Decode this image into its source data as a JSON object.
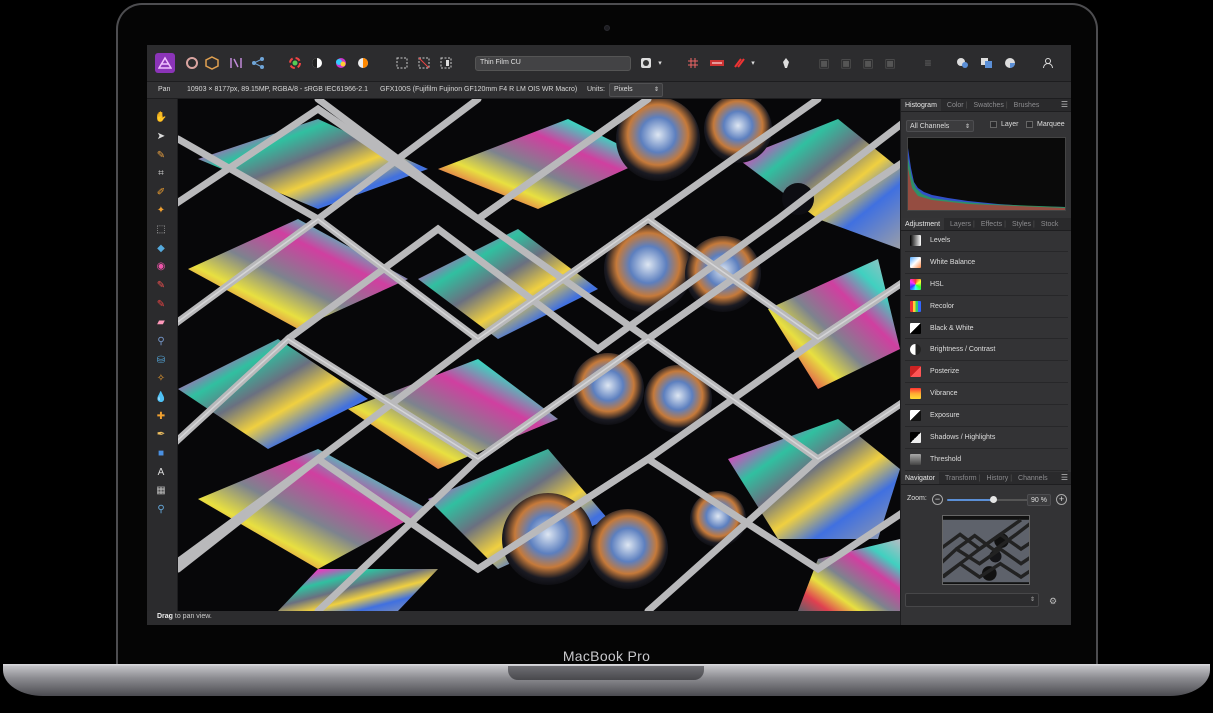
{
  "device": {
    "brand": "MacBook Pro"
  },
  "toolbar": {
    "document_title": "Thin Film CU"
  },
  "context_bar": {
    "tool": "Pan",
    "image_info": "10903 × 8177px, 89.15MP, RGBA/8 - sRGB IEC61966-2.1",
    "camera_info": "GFX100S (Fujifilm Fujinon GF120mm F4 R LM OIS WR Macro)",
    "units_label": "Units:",
    "units_value": "Pixels"
  },
  "status": {
    "bold": "Drag",
    "rest": " to pan view."
  },
  "histogram_panel": {
    "tabs": [
      "Histogram",
      "Color",
      "Swatches",
      "Brushes"
    ],
    "channel": "All Channels",
    "layer_label": "Layer",
    "marquee_label": "Marquee"
  },
  "adjustment_panel": {
    "tabs": [
      "Adjustment",
      "Layers",
      "Effects",
      "Styles",
      "Stock"
    ],
    "items": [
      "Levels",
      "White Balance",
      "HSL",
      "Recolor",
      "Black & White",
      "Brightness / Contrast",
      "Posterize",
      "Vibrance",
      "Exposure",
      "Shadows / Highlights",
      "Threshold"
    ]
  },
  "navigator_panel": {
    "tabs": [
      "Navigator",
      "Transform",
      "History",
      "Channels"
    ],
    "zoom_label": "Zoom:",
    "zoom_value": "90 %",
    "zoom_fraction": 0.56
  },
  "colors": {
    "accent": "#5b8fd6",
    "app_logo": "#b04fd0"
  }
}
